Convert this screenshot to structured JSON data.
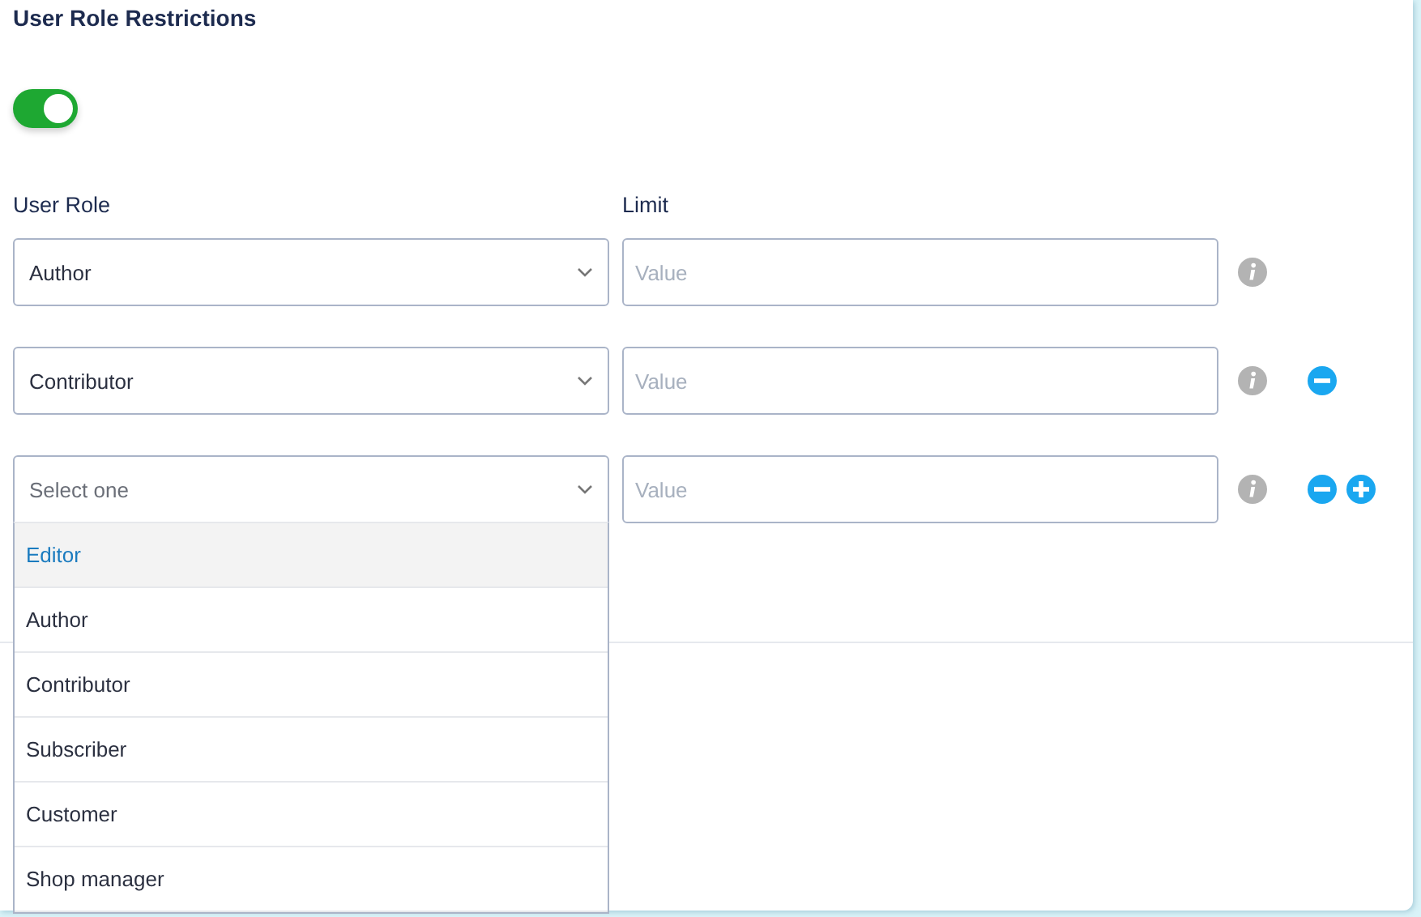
{
  "title": "User Role Restrictions",
  "enabled": true,
  "columns": [
    "User Role",
    "Limit"
  ],
  "rows": [
    {
      "role": {
        "value": "Author",
        "expanded": false
      },
      "limit": {
        "placeholder": "Value"
      },
      "remove": false,
      "add": false
    },
    {
      "role": {
        "value": "Contributor",
        "expanded": false
      },
      "limit": {
        "placeholder": "Value"
      },
      "remove": true,
      "add": false
    },
    {
      "role": {
        "placeholder": "Select one",
        "expanded": true,
        "options": [
          {
            "label": "Editor",
            "selected": true
          },
          {
            "label": "Author",
            "selected": false
          },
          {
            "label": "Contributor",
            "selected": false
          },
          {
            "label": "Subscriber",
            "selected": false
          },
          {
            "label": "Customer",
            "selected": false
          },
          {
            "label": "Shop manager",
            "selected": false
          }
        ]
      },
      "limit": {
        "placeholder": "Value"
      },
      "remove": true,
      "add": true
    }
  ]
}
